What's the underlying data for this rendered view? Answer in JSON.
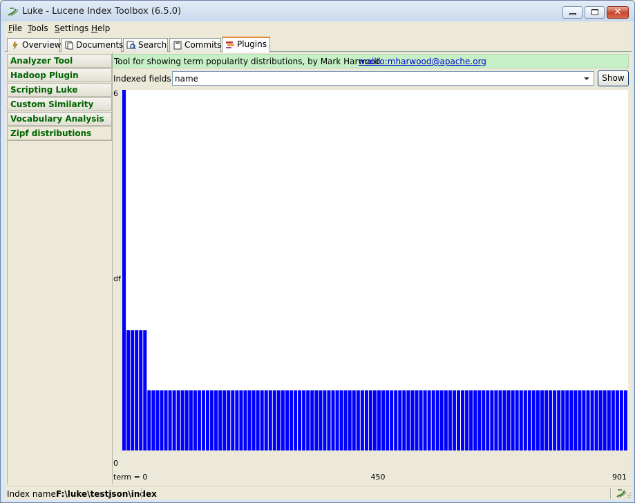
{
  "window": {
    "title": "Luke - Lucene Index Toolbox (6.5.0)",
    "icons": [
      "luke-app-icon",
      "minimize-icon",
      "maximize-icon",
      "close-icon"
    ]
  },
  "menu": [
    {
      "label": "File",
      "mnemonic": "F",
      "rest": "ile"
    },
    {
      "label": "Tools",
      "mnemonic": "T",
      "rest": "ools"
    },
    {
      "label": "Settings",
      "mnemonic": "S",
      "rest": "ettings"
    },
    {
      "label": "Help",
      "mnemonic": "H",
      "rest": "elp"
    }
  ],
  "tabs": [
    {
      "label": "Overview",
      "icon": "overview-icon"
    },
    {
      "label": "Documents",
      "icon": "documents-icon"
    },
    {
      "label": "Search",
      "icon": "search-icon"
    },
    {
      "label": "Commits",
      "icon": "commits-icon"
    },
    {
      "label": "Plugins",
      "icon": "plugins-icon",
      "active": true
    }
  ],
  "plugins": [
    "Analyzer Tool",
    "Hadoop Plugin",
    "Scripting Luke",
    "Custom Similarity",
    "Vocabulary Analysis Tool",
    "Zipf distributions"
  ],
  "selected_plugin": "Zipf distributions",
  "plugin_panel": {
    "description": "Tool for showing term popularity distributions, by Mark Harwood",
    "link": "mailto:mharwood@apache.org",
    "fields_label": "Indexed fields:",
    "field_value": "name",
    "show_label": "Show"
  },
  "chart_data": {
    "type": "bar",
    "ylabel": "df",
    "xlabel": "",
    "y_ticks": [
      "6",
      "0"
    ],
    "x_ticks": [
      "term = 0",
      "450",
      "901"
    ],
    "ylim": [
      0,
      6
    ],
    "bar_color": "#0000ff",
    "values": [
      6,
      2,
      2,
      2,
      2,
      2,
      1,
      1,
      1,
      1,
      1,
      1,
      1,
      1,
      1,
      1,
      1,
      1,
      1,
      1,
      1,
      1,
      1,
      1,
      1,
      1,
      1,
      1,
      1,
      1,
      1,
      1,
      1,
      1,
      1,
      1,
      1,
      1,
      1,
      1,
      1,
      1,
      1,
      1,
      1,
      1,
      1,
      1,
      1,
      1,
      1,
      1,
      1,
      1,
      1,
      1,
      1,
      1,
      1,
      1,
      1,
      1,
      1,
      1,
      1,
      1,
      1,
      1,
      1,
      1,
      1,
      1,
      1,
      1,
      1,
      1,
      1,
      1,
      1,
      1,
      1,
      1,
      1,
      1,
      1,
      1,
      1,
      1,
      1,
      1,
      1,
      1,
      1,
      1,
      1,
      1,
      1,
      1,
      1,
      1,
      1,
      1,
      1,
      1,
      1,
      1,
      1,
      1,
      1,
      1,
      1,
      1,
      1,
      1,
      1,
      1,
      1,
      1,
      1,
      1,
      1
    ]
  },
  "status": {
    "label": "Index name:",
    "value": "F:\\luke\\testjson\\index",
    "icon": "luke-status-icon"
  }
}
